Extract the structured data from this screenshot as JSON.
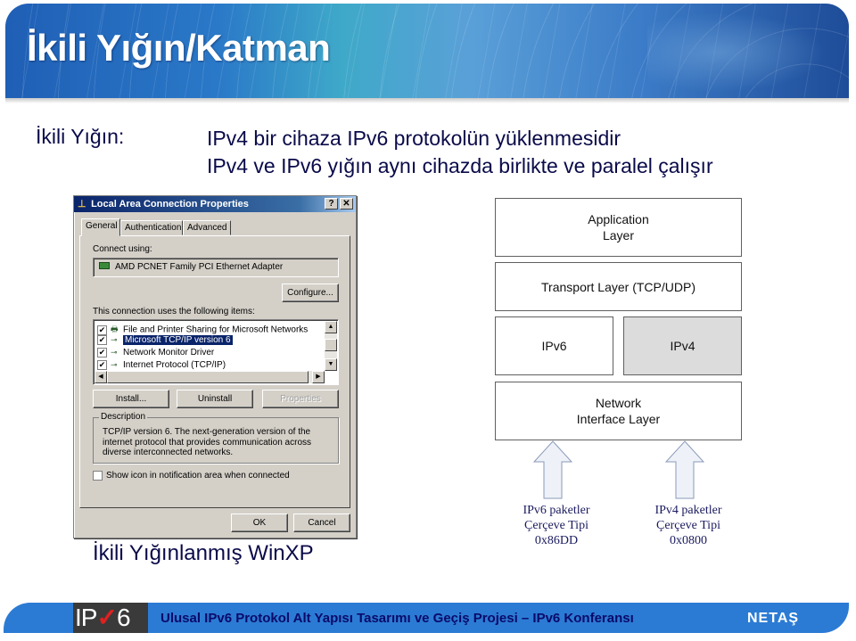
{
  "header": {
    "title": "İkili Yığın/Katman"
  },
  "intro": {
    "label": "İkili Yığın:",
    "lines": [
      "IPv4 bir cihaza IPv6 protokolün yüklenmesidir",
      "IPv4 ve IPv6 yığın aynı cihazda birlikte ve paralel çalışır"
    ]
  },
  "dialog": {
    "title": "Local Area Connection Properties",
    "help_btn": "?",
    "close_btn": "✕",
    "tabs": [
      "General",
      "Authentication",
      "Advanced"
    ],
    "active_tab": "General",
    "connect_using_label": "Connect using:",
    "adapter": "AMD PCNET Family PCI Ethernet Adapter",
    "configure_btn": "Configure...",
    "items_label": "This connection uses the following items:",
    "items": [
      {
        "label": "File and Printer Sharing for Microsoft Networks",
        "checked": true,
        "selected": false,
        "icon": "printer-icon"
      },
      {
        "label": "Microsoft TCP/IP version 6",
        "checked": true,
        "selected": true,
        "icon": "network-protocol-icon"
      },
      {
        "label": "Network Monitor Driver",
        "checked": true,
        "selected": false,
        "icon": "network-protocol-icon"
      },
      {
        "label": "Internet Protocol (TCP/IP)",
        "checked": true,
        "selected": false,
        "icon": "network-protocol-icon"
      }
    ],
    "install_btn": "Install...",
    "uninstall_btn": "Uninstall",
    "properties_btn": "Properties",
    "description_title": "Description",
    "description": "TCP/IP version 6. The next-generation version of the internet protocol that provides communication across diverse interconnected networks.",
    "show_icon_label": "Show icon in notification area when connected",
    "show_icon_checked": false,
    "ok_btn": "OK",
    "cancel_btn": "Cancel",
    "check_glyph": "✔"
  },
  "caption_left": "İkili Yığınlanmış WinXP",
  "diagram": {
    "layers": {
      "application": "Application\nLayer",
      "transport": "Transport Layer (TCP/UDP)",
      "ipv6": "IPv6",
      "ipv4": "IPv4",
      "network_interface": "Network\nInterface Layer"
    },
    "packets": [
      {
        "lines": [
          "IPv6 paketler",
          "Çerçeve Tipi",
          "0x86DD"
        ]
      },
      {
        "lines": [
          "IPv4 paketler",
          "Çerçeve Tipi",
          "0x0800"
        ]
      }
    ]
  },
  "footer": {
    "logo_text": "IP",
    "logo_check": "✓",
    "logo_num": "6",
    "text": "Ulusal IPv6 Protokol Alt Yapısı Tasarımı ve Geçiş Projesi – IPv6 Konferansı",
    "brand": "NETAŞ"
  }
}
